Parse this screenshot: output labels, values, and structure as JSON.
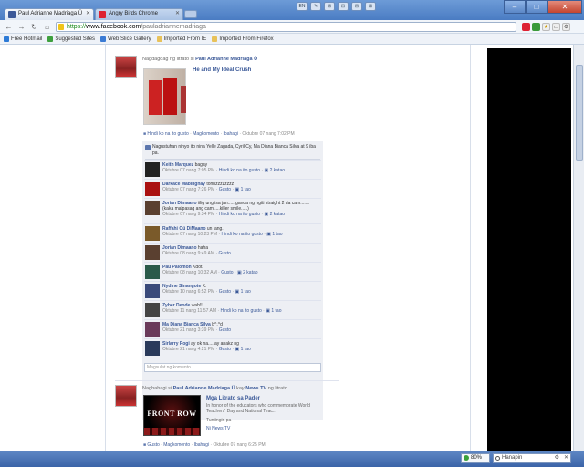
{
  "browser": {
    "tabs": [
      {
        "title": "Paul Adrianne Madriaga Ü",
        "active": true
      },
      {
        "title": "Angry Birds Chrome",
        "active": false
      }
    ],
    "toolbar_icons": [
      "EN",
      "✎",
      "⊞",
      "⊡",
      "⊟",
      "⊠"
    ],
    "url_scheme": "https://",
    "url_host": "www.facebook.com",
    "url_path": "/pauladriannemadriaga",
    "bookmarks": [
      "Free Hotmail",
      "Suggested Sites",
      "Web Slice Gallery",
      "Imported From IE",
      "Imported From Firefox"
    ],
    "zoom": "80%",
    "find_placeholder": "Hanapin"
  },
  "post1": {
    "actor_prefix": "Nagdagdag ng litrato si",
    "actor_name": "Paul Adrianne Madriaga Ü",
    "album_title": "He and My Ideal Crush",
    "meta": {
      "unlike": "Hindi ko na ito gusto",
      "comment": "Magkomento",
      "share": "Ibahagi",
      "time": "Oktubre 07 nang 7:02 PM"
    },
    "likes_text": "Nagustuhan ninyo ito nina Yelle Zagada, Cyril Cy, Ma Diana Bianca Silva at 9 iba pa.",
    "comments": [
      {
        "name": "Keith Marquez",
        "text": "bagay",
        "time": "Oktubre 07 nang 7:05 PM",
        "action": "Hindi ko na ito gusto",
        "likes": "2 katao"
      },
      {
        "name": "Darkace Mabingnay",
        "text": "tohhzzzzzzzz",
        "time": "Oktubre 07 nang 7:26 PM",
        "action": "Gusto",
        "likes": "1 tao"
      },
      {
        "name": "Jorian Dimaano",
        "text": "iilig ung isa jan......ganda ng ngiti straight 2 da cam.......(kaka malpasag ang cam.....killer smile.....)",
        "time": "Oktubre 07 nang 9:34 PM",
        "action": "Hindi ko na ito gusto",
        "likes": "2 katao"
      },
      {
        "name": "Raffahi Oü DiMaano",
        "text": "un lang.",
        "time": "Oktubre 07 nang 10:23 PM",
        "action": "Hindi ko na ito gusto",
        "likes": "1 tao"
      },
      {
        "name": "Jorian Dimaano",
        "text": "haha",
        "time": "Oktubre 08 nang 9:49 AM",
        "action": "Gusto",
        "likes": ""
      },
      {
        "name": "Pau Palomon",
        "text": "Kdot.",
        "time": "Oktubre 08 nang 10:32 AM",
        "action": "Gusto",
        "likes": "2 katao"
      },
      {
        "name": "Nydine Sinangote",
        "text": "K.",
        "time": "Oktubre 10 nang 6:52 PM",
        "action": "Gusto",
        "likes": "1 tao"
      },
      {
        "name": "Zyber Deode",
        "text": "wah!!!",
        "time": "Oktubre 11 nang 11:57 AM",
        "action": "Hindi ko na ito gusto",
        "likes": "1 tao"
      },
      {
        "name": "Ma Diana Bianca Silva",
        "text": "b^.^d",
        "time": "Oktubre 21 nang 3:39 PM",
        "action": "Gusto",
        "likes": ""
      },
      {
        "name": "Sirlarry Pogi",
        "text": "ay ok na.....ay anakz ng",
        "time": "Oktubre 21 nang 4:21 PM",
        "action": "Gusto",
        "likes": "1 tao"
      }
    ],
    "comment_placeholder": "Magsulat ng komento..."
  },
  "post2": {
    "actor_prefix": "Nagbahagi si",
    "actor_name": "Paul Adrianne Madriaga Ü",
    "actor_suffix_1": "kay",
    "page_name": "News TV",
    "actor_suffix_2": "ng litrato.",
    "thumb_text": "FRONT ROW",
    "share_title": "Mga Litrato sa Pader",
    "share_desc": "In honor of the educators who commemorate World Teachers' Day and National Teac...",
    "share_sub": "Tuntingin pa",
    "share_via": "Ni News TV",
    "meta": {
      "like": "Gusto",
      "comment": "Magkomento",
      "share": "Ibahagi",
      "time": "Oktubre 07 nang 6:25 PM"
    }
  }
}
